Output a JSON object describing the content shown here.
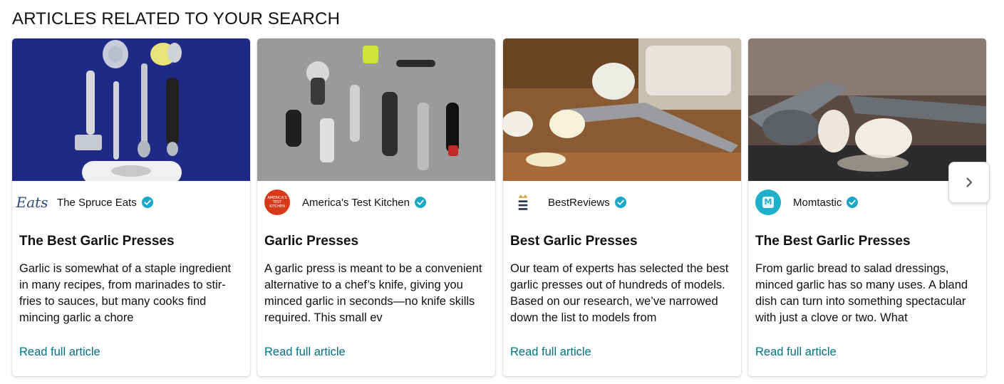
{
  "section": {
    "title": "ARTICLES RELATED TO YOUR SEARCH"
  },
  "accent_colors": {
    "link": "#007185",
    "verified": "#1aa7c8"
  },
  "articles": [
    {
      "image_icon": "garlic-press-tools-blue-image",
      "publisher_logo_text": "Eats",
      "publisher": "The Spruce Eats",
      "title": "The Best Garlic Presses",
      "description": "Garlic is somewhat of a staple ingredient in many recipes, from marinades to stir-fries to sauces, but many cooks find mincing garlic a chore",
      "link": "Read full article"
    },
    {
      "image_icon": "garlic-press-tools-gray-image",
      "publisher_logo_text": "AMERICA'S TEST KITCHEN",
      "publisher": "America's Test Kitchen",
      "title": "Garlic Presses",
      "description": "A garlic press is meant to be a convenient alternative to a chef’s knife, giving you minced garlic in seconds—no knife skills required. This small ev",
      "link": "Read full article"
    },
    {
      "image_icon": "garlic-press-wood-board-image",
      "publisher_logo_text": "",
      "publisher": "BestReviews",
      "title": "Best Garlic Presses",
      "description": "Our team of experts has selected the best garlic presses out of hundreds of models. Based on our research, we’ve narrowed down the list to models from",
      "link": "Read full article"
    },
    {
      "image_icon": "garlic-cloves-press-image",
      "publisher_logo_text": "M",
      "publisher": "Momtastic",
      "title": "The Best Garlic Presses",
      "description": "From garlic bread to salad dressings, minced garlic has so many uses. A bland dish can turn into something spectacular with just a clove or two. What",
      "link": "Read full article"
    }
  ],
  "carousel": {
    "next_icon": "chevron-right-icon"
  }
}
